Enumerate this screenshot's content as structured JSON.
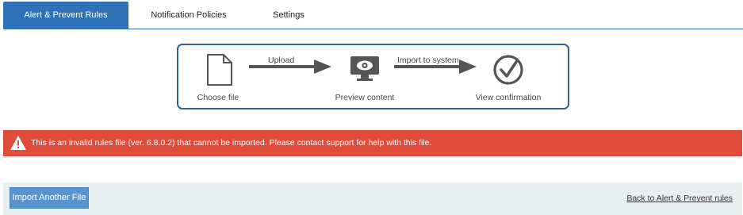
{
  "tabs": [
    {
      "label": "Alert & Prevent Rules",
      "active": true
    },
    {
      "label": "Notification Policies",
      "active": false
    },
    {
      "label": "Settings",
      "active": false
    }
  ],
  "stepper": {
    "steps": [
      {
        "label": "Choose file",
        "icon": "file-icon"
      },
      {
        "label": "Preview content",
        "icon": "monitor-eye-icon"
      },
      {
        "label": "View confirmation",
        "icon": "check-circle-icon"
      }
    ],
    "arrows": [
      {
        "label": "Upload"
      },
      {
        "label": "Import to system"
      }
    ]
  },
  "alert": {
    "icon": "warning-icon",
    "message": "This is an invalid rules file (ver. 6.8.0.2) that cannot be imported. Please contact support for help with this file.",
    "color": "#e04b3a"
  },
  "footer": {
    "import_button": "Import Another File",
    "back_link": "Back to Alert & Prevent rules"
  },
  "colors": {
    "accent": "#2e73b9",
    "stepper_border": "#2d6292",
    "icon_gray": "#555555"
  }
}
